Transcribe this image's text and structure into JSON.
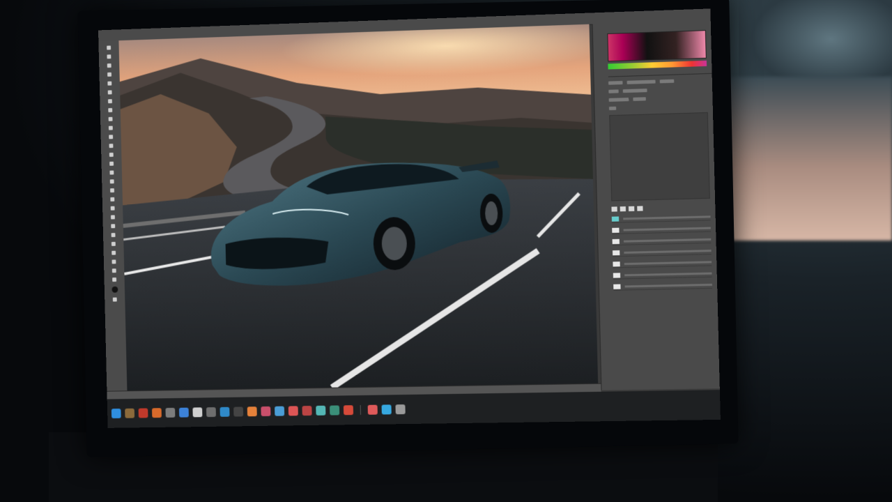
{
  "app": {
    "title": "",
    "status": ""
  },
  "panels": {
    "tabs": [
      "",
      "",
      ""
    ]
  },
  "dock": {
    "icons": [
      {
        "name": "finder-icon",
        "color": "#2f8fe0"
      },
      {
        "name": "folder-icon",
        "color": "#8b6a3b"
      },
      {
        "name": "photos-icon",
        "color": "#c0392b"
      },
      {
        "name": "notes-icon",
        "color": "#d86a2b"
      },
      {
        "name": "settings-icon",
        "color": "#7c7c7c"
      },
      {
        "name": "browser-icon",
        "color": "#3c82d8"
      },
      {
        "name": "mail-icon",
        "color": "#cfcfcf"
      },
      {
        "name": "messages-icon",
        "color": "#6e6e6e"
      },
      {
        "name": "app-icon",
        "color": "#2f89c8"
      },
      {
        "name": "camera-icon",
        "color": "#444444"
      },
      {
        "name": "music-icon",
        "color": "#e5813a"
      },
      {
        "name": "calendar-icon",
        "color": "#c94f6b"
      },
      {
        "name": "maps-icon",
        "color": "#4a9dd6"
      },
      {
        "name": "store-icon",
        "color": "#dd5555"
      },
      {
        "name": "video-icon",
        "color": "#bb4444"
      },
      {
        "name": "clock-icon",
        "color": "#54b7b5"
      },
      {
        "name": "terminal-icon",
        "color": "#3b8f79"
      },
      {
        "name": "chrome-icon",
        "color": "#d64a3a"
      },
      {
        "name": "photo-editor-icon",
        "color": "#df5a5a"
      },
      {
        "name": "docs-icon",
        "color": "#36a8e0"
      },
      {
        "name": "trash-icon",
        "color": "#9a9a9a"
      }
    ]
  }
}
